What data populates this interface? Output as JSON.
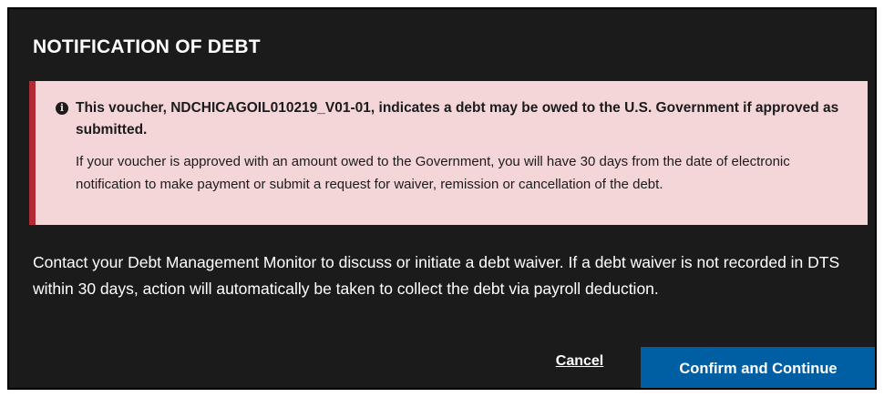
{
  "dialog": {
    "title": "NOTIFICATION OF DEBT",
    "alert": {
      "icon": "info-circle-icon",
      "heading": "This voucher, NDCHICAGOIL010219_V01-01, indicates a debt may be owed to the U.S. Government if approved as submitted.",
      "body": "If your voucher is approved with an amount owed to the Government, you will have 30 days from the date of electronic notification to make payment or submit a request for waiver, remission or cancellation of the debt.",
      "background_color": "#f4d6d9",
      "border_color": "#b22a35"
    },
    "message": "Contact your Debt Management Monitor to discuss or initiate a debt waiver. If a debt waiver is not recorded in DTS within 30 days, action will automatically be taken to collect the debt via payroll deduction.",
    "cancel_label": "Cancel",
    "confirm_label": "Confirm and Continue",
    "confirm_color": "#005ea2",
    "background_color": "#1b1b1b"
  }
}
